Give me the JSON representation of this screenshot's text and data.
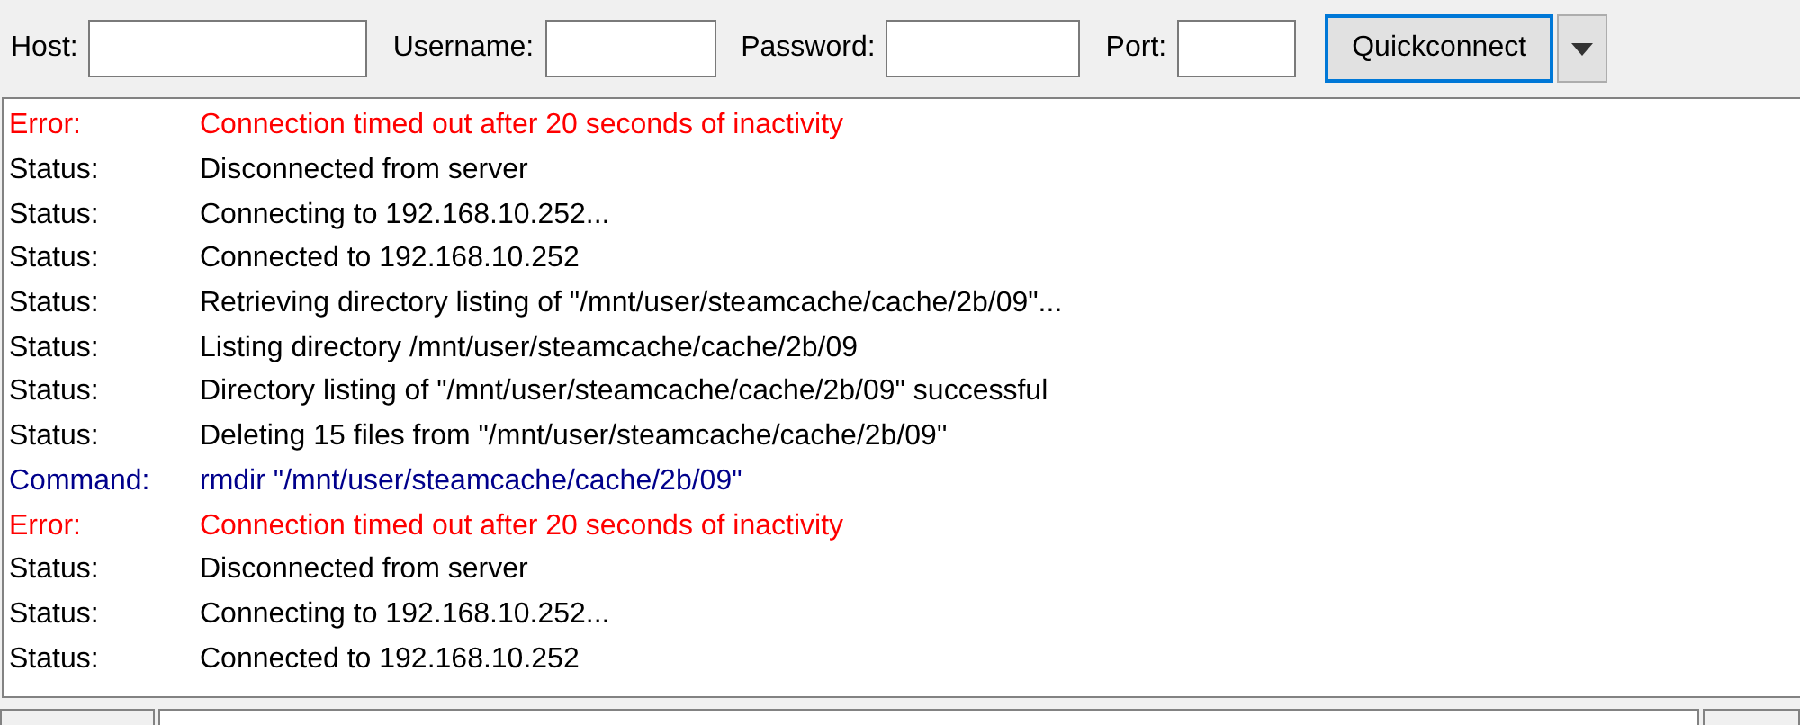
{
  "quickconnect": {
    "fields": [
      {
        "label": "Host:"
      },
      {
        "label": "Username:"
      },
      {
        "label": "Password:"
      },
      {
        "label": "Port:"
      }
    ],
    "button": "Quickconnect"
  },
  "log": [
    {
      "kind": "error",
      "type": "Error:",
      "message": "Connection timed out after 20 seconds of inactivity"
    },
    {
      "kind": "status",
      "type": "Status:",
      "message": "Disconnected from server"
    },
    {
      "kind": "status",
      "type": "Status:",
      "message": "Connecting to 192.168.10.252..."
    },
    {
      "kind": "status",
      "type": "Status:",
      "message": "Connected to 192.168.10.252"
    },
    {
      "kind": "status",
      "type": "Status:",
      "message": "Retrieving directory listing of \"/mnt/user/steamcache/cache/2b/09\"..."
    },
    {
      "kind": "status",
      "type": "Status:",
      "message": "Listing directory /mnt/user/steamcache/cache/2b/09"
    },
    {
      "kind": "status",
      "type": "Status:",
      "message": "Directory listing of \"/mnt/user/steamcache/cache/2b/09\" successful"
    },
    {
      "kind": "status",
      "type": "Status:",
      "message": "Deleting 15 files from \"/mnt/user/steamcache/cache/2b/09\""
    },
    {
      "kind": "command",
      "type": "Command:",
      "message": "rmdir \"/mnt/user/steamcache/cache/2b/09\""
    },
    {
      "kind": "error",
      "type": "Error:",
      "message": "Connection timed out after 20 seconds of inactivity"
    },
    {
      "kind": "status",
      "type": "Status:",
      "message": "Disconnected from server"
    },
    {
      "kind": "status",
      "type": "Status:",
      "message": "Connecting to 192.168.10.252..."
    },
    {
      "kind": "status",
      "type": "Status:",
      "message": "Connected to 192.168.10.252"
    }
  ]
}
